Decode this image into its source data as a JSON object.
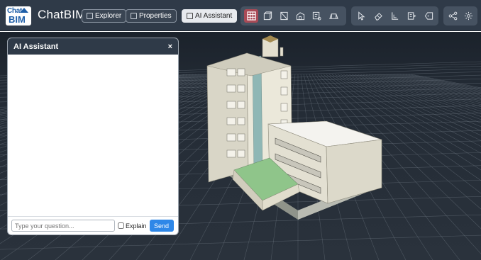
{
  "app": {
    "logo_top": "Chat",
    "logo_bottom": "BIM",
    "title": "ChatBIM"
  },
  "toolbar": {
    "explorer_label": "Explorer",
    "properties_label": "Properties",
    "assistant_label": "AI Assistant",
    "view_tools": [
      "grid-plan-icon",
      "box-view-icon",
      "section-icon",
      "elevation-icon",
      "sheet-icon",
      "perspective-icon"
    ],
    "edit_tools": [
      "select-cursor-icon",
      "eraser-icon",
      "measure-angle-icon",
      "cut-plane-icon",
      "tag-icon"
    ],
    "extra_tools": [
      "share-icon",
      "settings-gear-icon"
    ]
  },
  "assistant_panel": {
    "title": "AI Assistant",
    "close_label": "×",
    "input_placeholder": "Type your question...",
    "explain_label": "Explain",
    "send_label": "Send"
  },
  "colors": {
    "topbar": "#2f3a48",
    "active_tool": "#a94b57",
    "send": "#2e87e8",
    "viewport_bg": "#222a33"
  }
}
